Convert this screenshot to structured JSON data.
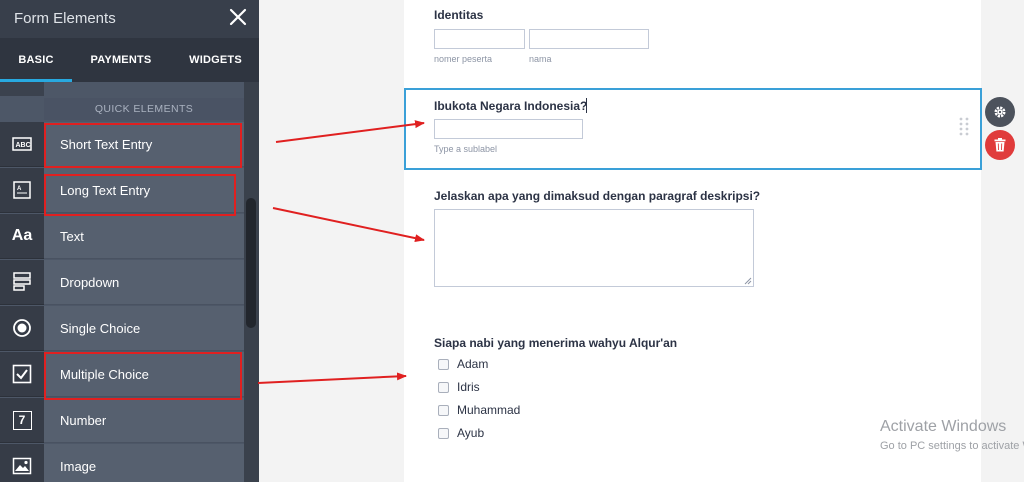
{
  "sidebar": {
    "title": "Form Elements",
    "tabs": [
      {
        "label": "BASIC",
        "active": true
      },
      {
        "label": "PAYMENTS",
        "active": false
      },
      {
        "label": "WIDGETS",
        "active": false
      }
    ],
    "section_title": "QUICK ELEMENTS",
    "items": [
      {
        "label": "Short Text Entry",
        "icon": "short-text-icon",
        "highlighted": true
      },
      {
        "label": "Long Text Entry",
        "icon": "long-text-icon",
        "highlighted": true
      },
      {
        "label": "Text",
        "icon": "text-aa-icon",
        "icon_glyph": "Aa",
        "highlighted": false
      },
      {
        "label": "Dropdown",
        "icon": "dropdown-icon",
        "highlighted": false
      },
      {
        "label": "Single Choice",
        "icon": "radio-icon",
        "highlighted": false
      },
      {
        "label": "Multiple Choice",
        "icon": "checkbox-icon",
        "highlighted": true
      },
      {
        "label": "Number",
        "icon": "number-icon",
        "icon_glyph": "7",
        "highlighted": false
      },
      {
        "label": "Image",
        "icon": "image-icon",
        "highlighted": false
      }
    ]
  },
  "form": {
    "identitas": {
      "label": "Identitas",
      "sublabels": [
        "nomer peserta",
        "nama"
      ]
    },
    "capital_question": {
      "label": "Ibukota Negara Indonesia?",
      "sublabel_placeholder": "Type a sublabel"
    },
    "paragraph_question": {
      "label": "Jelaskan apa yang dimaksud dengan paragraf deskripsi?"
    },
    "prophet_question": {
      "label": "Siapa nabi yang menerima wahyu Alqur'an",
      "options": [
        "Adam",
        "Idris",
        "Muhammad",
        "Ayub"
      ]
    }
  },
  "watermark": {
    "line1": "Activate Windows",
    "line2": "Go to PC settings to activate Windows."
  },
  "colors": {
    "sidebar_bg": "#4d5767",
    "accent_blue": "#28a9e0",
    "highlight_red": "#e02020",
    "delete_red": "#e03b3b"
  }
}
